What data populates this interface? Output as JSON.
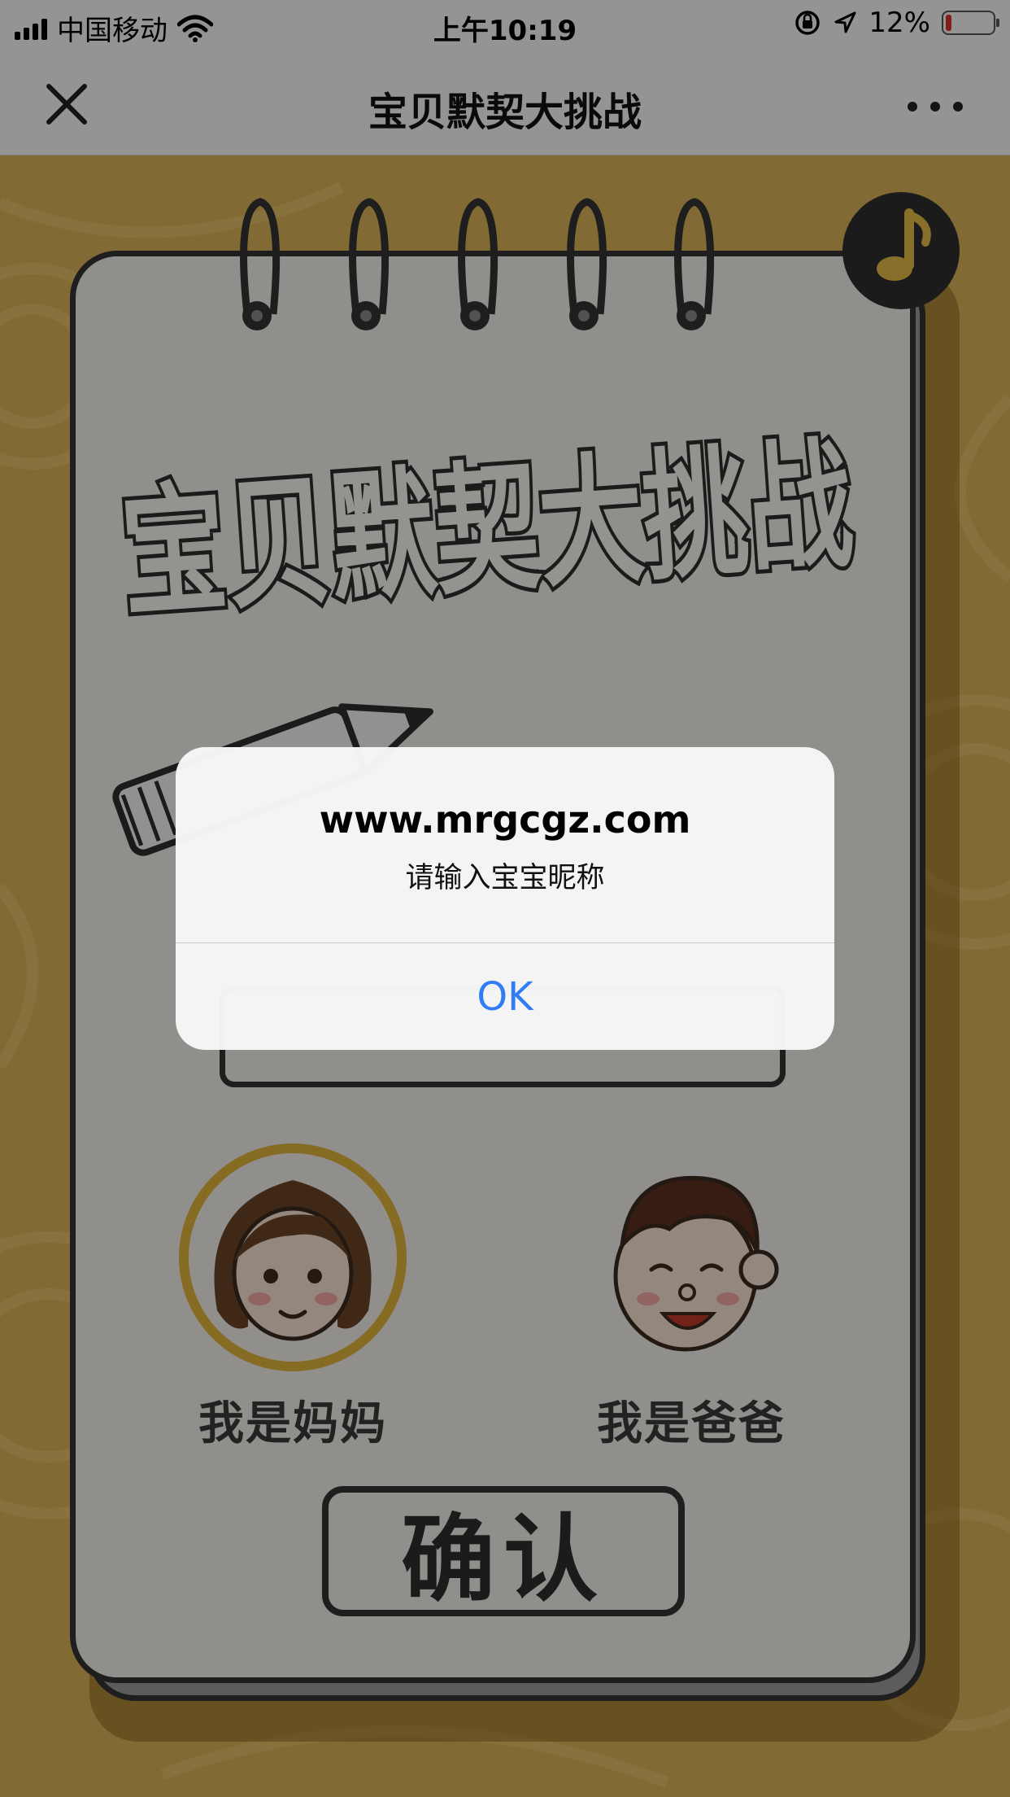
{
  "status_bar": {
    "carrier": "中国移动",
    "time": "上午10:19",
    "battery_percent": "12%",
    "battery_level": 0.12,
    "battery_color": "#e0302a"
  },
  "nav": {
    "title": "宝贝默契大挑战",
    "close_icon": "close-icon",
    "more_icon": "more-horizontal-icon"
  },
  "page": {
    "title_art_text": "宝贝默契大挑战",
    "mom_label": "我是妈妈",
    "dad_label": "我是爸爸",
    "confirm_label": "确认",
    "selected_role": "mom",
    "accent_color": "#d8b155"
  },
  "alert": {
    "title": "www.mrgcgz.com",
    "message": "请输入宝宝昵称",
    "ok_label": "OK",
    "ok_color": "#2f7cf6"
  }
}
